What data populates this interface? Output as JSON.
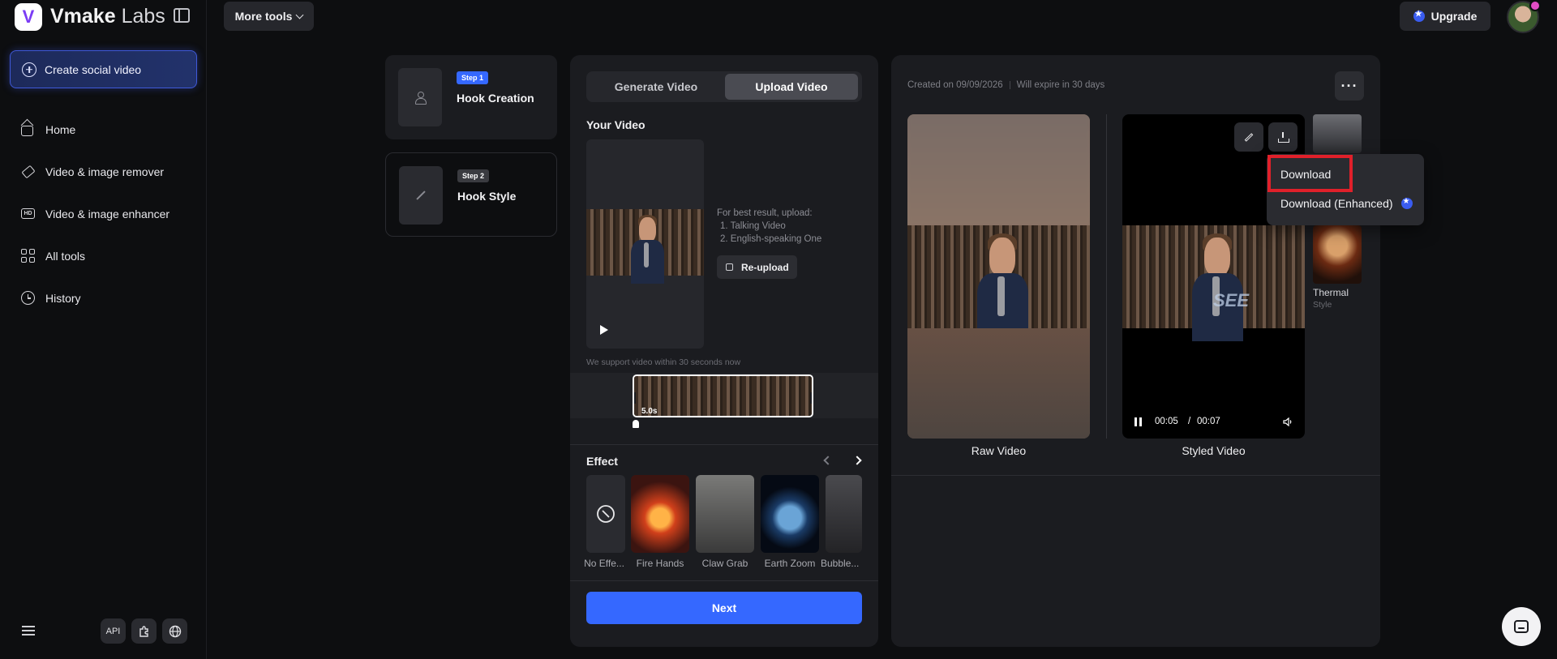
{
  "brand": {
    "name_bold": "Vmake",
    "name_light": " Labs",
    "logo_letter": "V"
  },
  "sidebar": {
    "create_label": "Create social video",
    "items": [
      {
        "label": "Home",
        "icon": "home-icon"
      },
      {
        "label": "Video & image remover",
        "icon": "eraser-icon"
      },
      {
        "label": "Video & image enhancer",
        "icon": "hd-icon"
      },
      {
        "label": "All tools",
        "icon": "grid-icon"
      },
      {
        "label": "History",
        "icon": "clock-icon"
      }
    ],
    "footer": {
      "api_label": "API"
    }
  },
  "topbar": {
    "more_tools_label": "More tools",
    "upgrade_label": "Upgrade"
  },
  "steps": [
    {
      "badge": "Step 1",
      "title": "Hook Creation",
      "badge_color": "#3568ff"
    },
    {
      "badge": "Step 2",
      "title": "Hook Style",
      "badge_color": "#3a3b40"
    }
  ],
  "upload_panel": {
    "tabs": [
      "Generate Video",
      "Upload Video"
    ],
    "active_tab": "Upload Video",
    "your_video_label": "Your Video",
    "hint_title": "For best result, upload:",
    "hint_1": "1. Talking Video",
    "hint_2": "2. English-speaking One",
    "reupload_label": "Re-upload",
    "support_note": "We support video within 30 seconds now",
    "timeline_duration": "5.0s",
    "effect_label": "Effect",
    "effects": [
      "No Effe...",
      "Fire Hands",
      "Claw Grab",
      "Earth Zoom",
      "Bubble..."
    ],
    "next_label": "Next"
  },
  "result_panel": {
    "created": "Created on 09/09/2026",
    "expire": "Will expire in 30 days",
    "more_label": "···",
    "raw_label": "Raw Video",
    "styled_label": "Styled Video",
    "time_current": "00:05",
    "time_sep": "/",
    "time_total": "00:07",
    "style_name": "Thermal",
    "style_sub": "Style",
    "overlay_text": "SEE"
  },
  "dropdown": {
    "download": "Download",
    "download_enhanced": "Download (Enhanced)"
  },
  "colors": {
    "accent": "#3568ff",
    "highlight": "#e0202a",
    "panel": "#1b1c20",
    "bg": "#0d0e10"
  }
}
